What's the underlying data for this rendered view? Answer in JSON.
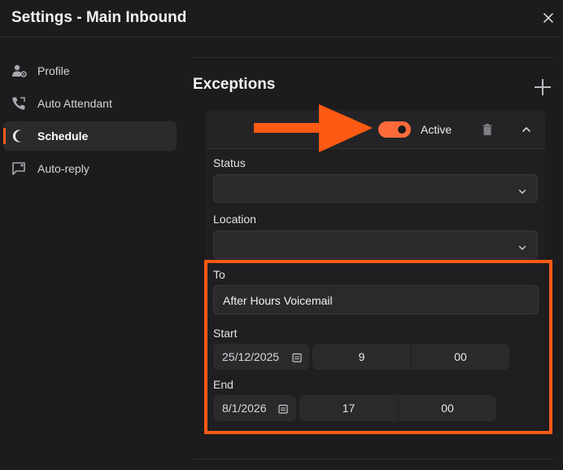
{
  "window": {
    "title": "Settings - Main Inbound"
  },
  "sidebar": {
    "items": [
      {
        "label": "Profile",
        "icon": "user-gear-icon"
      },
      {
        "label": "Auto Attendant",
        "icon": "phone-icon"
      },
      {
        "label": "Schedule",
        "icon": "moon-icon",
        "active": true
      },
      {
        "label": "Auto-reply",
        "icon": "chat-reply-icon"
      }
    ]
  },
  "exceptions": {
    "title": "Exceptions",
    "toggle_label": "Active",
    "toggle_on": true,
    "status": {
      "label": "Status",
      "value": ""
    },
    "location": {
      "label": "Location",
      "value": ""
    },
    "to": {
      "label": "To",
      "value": "After Hours Voicemail"
    },
    "start": {
      "label": "Start",
      "date": "25/12/2025",
      "hour": "9",
      "minute": "00"
    },
    "end": {
      "label": "End",
      "date": "8/1/2026",
      "hour": "17",
      "minute": "00"
    }
  },
  "colors": {
    "accent": "#ff5a14",
    "toggle": "#ff6a3a",
    "background": "#1c1c1e"
  }
}
